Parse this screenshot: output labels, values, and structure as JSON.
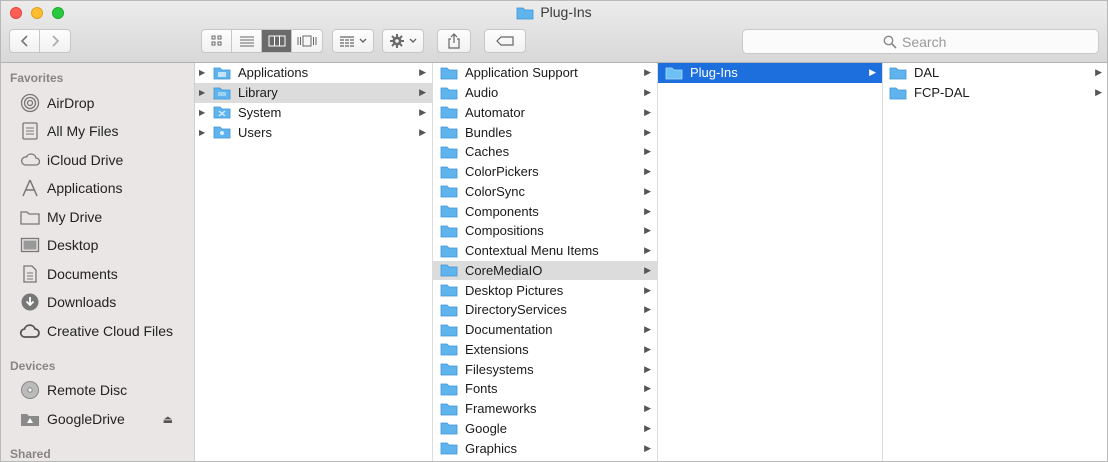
{
  "window": {
    "title": "Plug-Ins",
    "controls": [
      "close",
      "minimize",
      "zoom"
    ]
  },
  "toolbar": {
    "view_modes": [
      {
        "icon": "icon-view-icon",
        "active": false
      },
      {
        "icon": "list-view-icon",
        "active": false
      },
      {
        "icon": "column-view-icon",
        "active": true
      },
      {
        "icon": "cover-flow-icon",
        "active": false
      }
    ],
    "group_icon": "group-by-icon",
    "action_icon": "gear-icon",
    "share_icon": "share-icon",
    "tag_icon": "tag-icon",
    "search_placeholder": "Search"
  },
  "sidebar": {
    "favorites_label": "Favorites",
    "favorites": [
      {
        "label": "AirDrop",
        "icon": "airdrop-icon"
      },
      {
        "label": "All My Files",
        "icon": "all-files-icon"
      },
      {
        "label": "iCloud Drive",
        "icon": "cloud-icon"
      },
      {
        "label": "Applications",
        "icon": "applications-icon"
      },
      {
        "label": "My Drive",
        "icon": "folder-icon"
      },
      {
        "label": "Desktop",
        "icon": "desktop-icon"
      },
      {
        "label": "Documents",
        "icon": "documents-icon"
      },
      {
        "label": "Downloads",
        "icon": "downloads-icon"
      },
      {
        "label": "Creative Cloud Files",
        "icon": "creative-cloud-icon"
      }
    ],
    "devices_label": "Devices",
    "devices": [
      {
        "label": "Remote Disc",
        "icon": "disc-icon"
      },
      {
        "label": "GoogleDrive",
        "icon": "drive-icon",
        "eject": true
      }
    ],
    "shared_label": "Shared"
  },
  "columns": [
    {
      "items": [
        {
          "label": "Applications",
          "selected": false
        },
        {
          "label": "Library",
          "selected": "inactive"
        },
        {
          "label": "System",
          "selected": false
        },
        {
          "label": "Users",
          "selected": false
        }
      ]
    },
    {
      "items": [
        {
          "label": "Application Support"
        },
        {
          "label": "Audio"
        },
        {
          "label": "Automator"
        },
        {
          "label": "Bundles"
        },
        {
          "label": "Caches"
        },
        {
          "label": "ColorPickers"
        },
        {
          "label": "ColorSync"
        },
        {
          "label": "Components"
        },
        {
          "label": "Compositions"
        },
        {
          "label": "Contextual Menu Items"
        },
        {
          "label": "CoreMediaIO",
          "selected": "inactive"
        },
        {
          "label": "Desktop Pictures"
        },
        {
          "label": "DirectoryServices"
        },
        {
          "label": "Documentation"
        },
        {
          "label": "Extensions"
        },
        {
          "label": "Filesystems"
        },
        {
          "label": "Fonts"
        },
        {
          "label": "Frameworks"
        },
        {
          "label": "Google"
        },
        {
          "label": "Graphics"
        }
      ]
    },
    {
      "items": [
        {
          "label": "Plug-Ins",
          "selected": "active"
        }
      ]
    },
    {
      "items": [
        {
          "label": "DAL"
        },
        {
          "label": "FCP-DAL"
        }
      ]
    }
  ],
  "colors": {
    "selection_blue": "#1e6fde",
    "selection_gray": "#dcdcdc",
    "folder_blue": "#5fb4ee",
    "sidebar_bg": "#ebe6e6"
  }
}
